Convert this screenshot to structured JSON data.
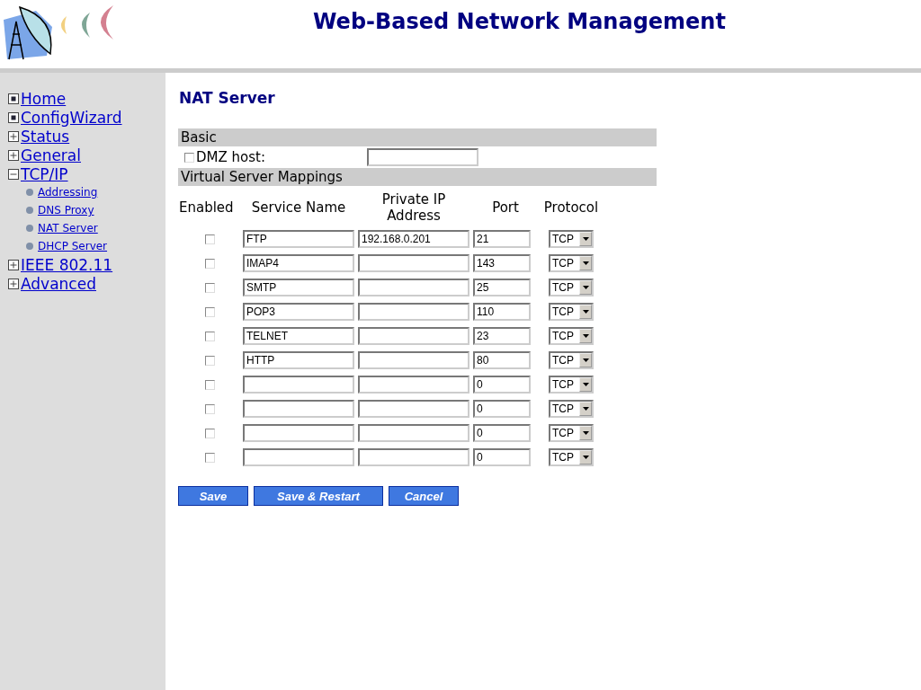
{
  "header": {
    "title": "Web-Based Network Management"
  },
  "sidebar": {
    "items": [
      {
        "label": "Home",
        "kind": "page"
      },
      {
        "label": "ConfigWizard",
        "kind": "page"
      },
      {
        "label": "Status",
        "kind": "folder",
        "expanded": false
      },
      {
        "label": "General",
        "kind": "folder",
        "expanded": false
      },
      {
        "label": "TCP/IP",
        "kind": "folder",
        "expanded": true,
        "children": [
          {
            "label": "Addressing"
          },
          {
            "label": "DNS Proxy"
          },
          {
            "label": "NAT Server"
          },
          {
            "label": "DHCP Server"
          }
        ]
      },
      {
        "label": "IEEE 802.11",
        "kind": "folder",
        "expanded": false
      },
      {
        "label": "Advanced",
        "kind": "folder",
        "expanded": false
      }
    ]
  },
  "page_title": "NAT Server",
  "basic": {
    "heading": "Basic",
    "dmz": {
      "label": "DMZ host:",
      "checked": false
    }
  },
  "mappings": {
    "heading": "Virtual Server Mappings",
    "columns": [
      "Enabled",
      "Service Name",
      "Private IP Address",
      "Port",
      "Protocol"
    ],
    "rows": [
      {
        "enabled": false,
        "service": "FTP",
        "ip": "192.168.0.201",
        "port": "21",
        "protocol": "TCP"
      },
      {
        "enabled": false,
        "service": "IMAP4",
        "port": "143",
        "protocol": "TCP"
      },
      {
        "enabled": false,
        "service": "SMTP",
        "port": "25",
        "protocol": "TCP"
      },
      {
        "enabled": false,
        "service": "POP3",
        "port": "110",
        "protocol": "TCP"
      },
      {
        "enabled": false,
        "service": "TELNET",
        "port": "23",
        "protocol": "TCP"
      },
      {
        "enabled": false,
        "service": "HTTP",
        "port": "80",
        "protocol": "TCP"
      },
      {
        "enabled": false,
        "port": "0",
        "protocol": "TCP"
      },
      {
        "enabled": false,
        "port": "0",
        "protocol": "TCP"
      },
      {
        "enabled": false,
        "port": "0",
        "protocol": "TCP"
      },
      {
        "enabled": false,
        "port": "0",
        "protocol": "TCP"
      }
    ]
  },
  "buttons": [
    "Save",
    "Save & Restart",
    "Cancel"
  ]
}
